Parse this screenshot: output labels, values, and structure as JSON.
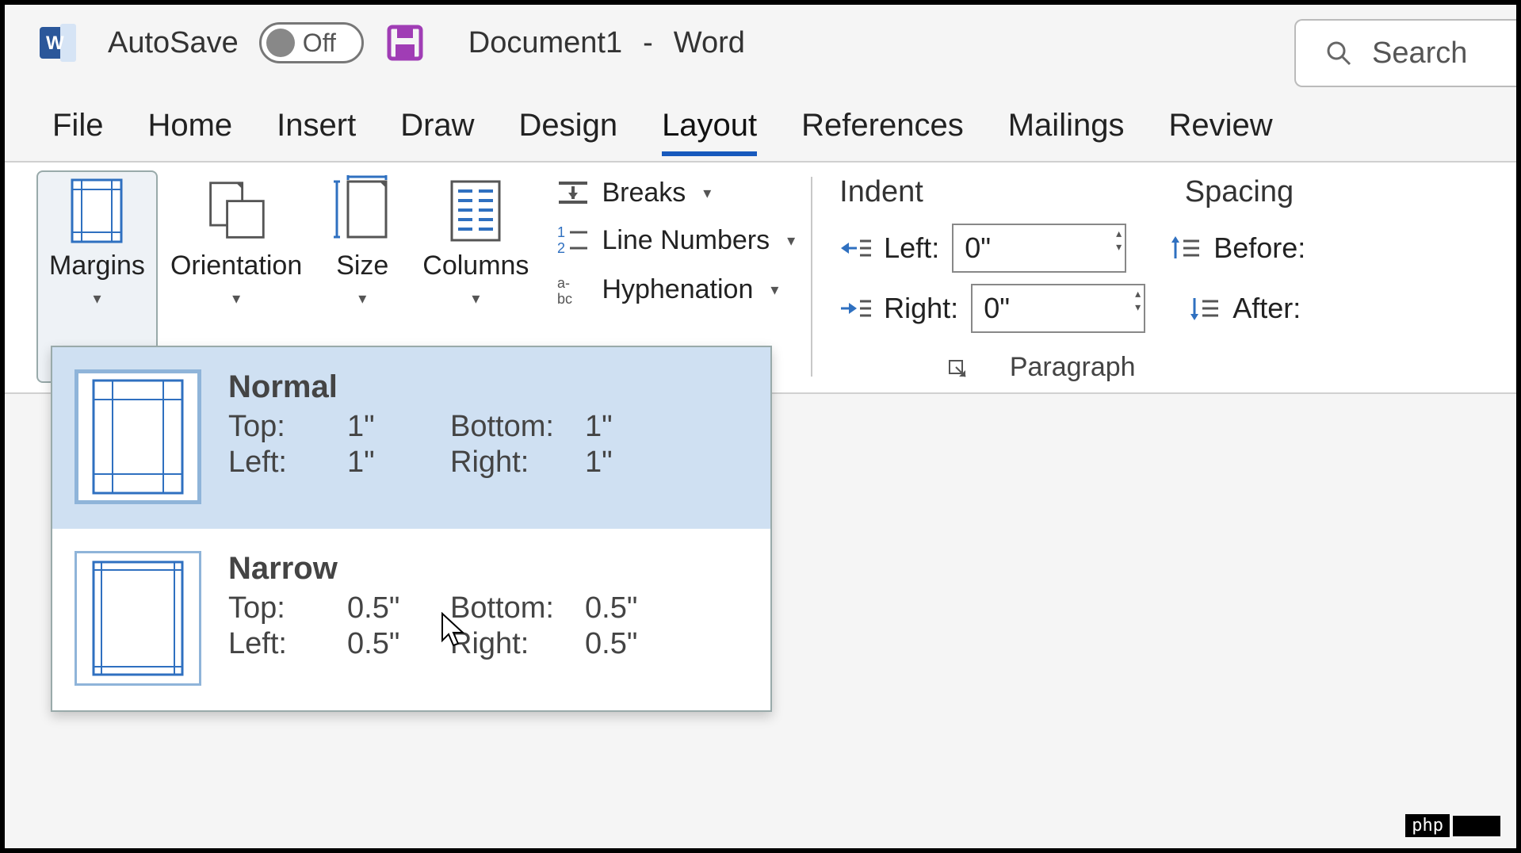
{
  "titlebar": {
    "autosave_label": "AutoSave",
    "toggle_state": "Off",
    "document_name": "Document1",
    "separator": "-",
    "app_name": "Word",
    "search_placeholder": "Search"
  },
  "tabs": [
    {
      "label": "File",
      "active": false
    },
    {
      "label": "Home",
      "active": false
    },
    {
      "label": "Insert",
      "active": false
    },
    {
      "label": "Draw",
      "active": false
    },
    {
      "label": "Design",
      "active": false
    },
    {
      "label": "Layout",
      "active": true
    },
    {
      "label": "References",
      "active": false
    },
    {
      "label": "Mailings",
      "active": false
    },
    {
      "label": "Review",
      "active": false
    }
  ],
  "ribbon": {
    "page_setup": {
      "margins": "Margins",
      "orientation": "Orientation",
      "size": "Size",
      "columns": "Columns",
      "breaks": "Breaks",
      "line_numbers": "Line Numbers",
      "hyphenation": "Hyphenation"
    },
    "paragraph": {
      "indent_label": "Indent",
      "spacing_label": "Spacing",
      "left_label": "Left:",
      "right_label": "Right:",
      "before_label": "Before:",
      "after_label": "After:",
      "left_value": "0\"",
      "right_value": "0\"",
      "group_label": "Paragraph"
    }
  },
  "margins_menu": [
    {
      "name": "Normal",
      "top_label": "Top:",
      "top": "1\"",
      "bottom_label": "Bottom:",
      "bottom": "1\"",
      "left_label": "Left:",
      "left": "1\"",
      "right_label": "Right:",
      "right": "1\"",
      "hover": true
    },
    {
      "name": "Narrow",
      "top_label": "Top:",
      "top": "0.5\"",
      "bottom_label": "Bottom:",
      "bottom": "0.5\"",
      "left_label": "Left:",
      "left": "0.5\"",
      "right_label": "Right:",
      "right": "0.5\"",
      "hover": false
    }
  ],
  "watermark": "php"
}
